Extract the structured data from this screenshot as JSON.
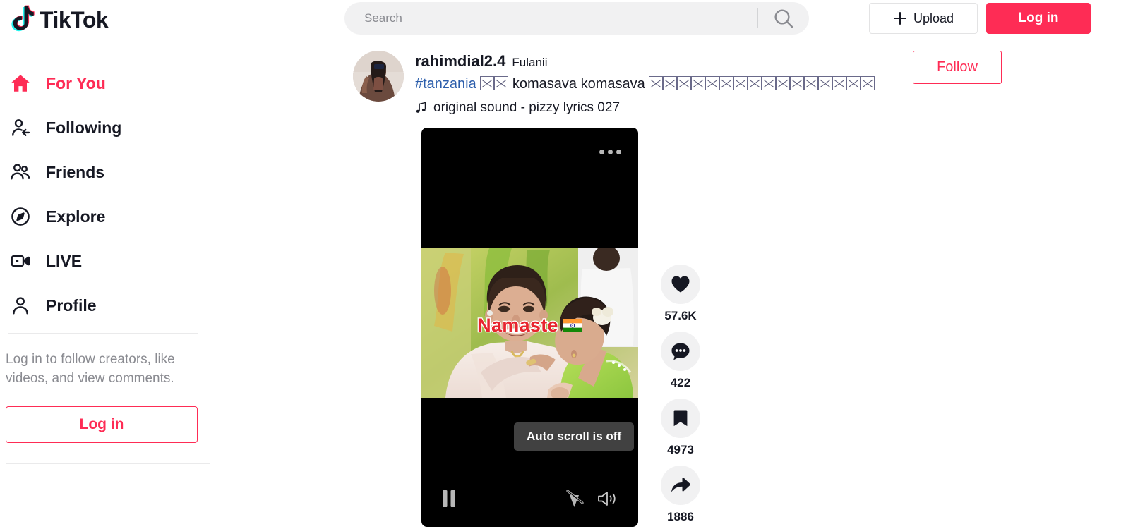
{
  "brand": {
    "name": "TikTok",
    "accent": "#fe2c55",
    "accent_cyan": "#25f4ee",
    "text": "#161823"
  },
  "topbar": {
    "logo_label": "TikTok",
    "search": {
      "placeholder": "Search",
      "value": "",
      "icon": "search-icon"
    },
    "upload": {
      "label": "Upload",
      "icon": "plus-icon"
    },
    "login": {
      "label": "Log in"
    }
  },
  "sidebar": {
    "items": [
      {
        "label": "For You",
        "icon": "home-icon",
        "active": true
      },
      {
        "label": "Following",
        "icon": "follow-icon",
        "active": false
      },
      {
        "label": "Friends",
        "icon": "friends-icon",
        "active": false
      },
      {
        "label": "Explore",
        "icon": "compass-icon",
        "active": false
      },
      {
        "label": "LIVE",
        "icon": "live-icon",
        "active": false
      },
      {
        "label": "Profile",
        "icon": "person-icon",
        "active": false
      }
    ],
    "login_prompt": "Log in to follow creators, like videos, and view comments.",
    "login_button": "Log in"
  },
  "post": {
    "username": "rahimdial2.4",
    "nickname": "Fulanii",
    "caption": {
      "hashtag": "#tanzania",
      "tofu_count_1": 2,
      "text": "komasava komasava",
      "tofu_count_2": 16
    },
    "music": {
      "icon": "music-note-icon",
      "label": "original sound - pizzy lyrics 027"
    },
    "follow_button": "Follow",
    "avatar": "avatar"
  },
  "player": {
    "more_icon": "more-dots-icon",
    "overlay_caption": "Namaste",
    "overlay_flag": "india-flag-emoji",
    "toast": "Auto scroll is off",
    "controls": {
      "play": {
        "icon": "pause-icon",
        "state": "playing"
      },
      "autoscroll": {
        "icon": "autoscroll-off-icon",
        "state": "off"
      },
      "volume": {
        "icon": "volume-on-icon",
        "state": "on"
      }
    }
  },
  "actions": [
    {
      "name": "like",
      "icon": "heart-icon",
      "count": "57.6K"
    },
    {
      "name": "comment",
      "icon": "comment-icon",
      "count": "422"
    },
    {
      "name": "bookmark",
      "icon": "bookmark-icon",
      "count": "4973"
    },
    {
      "name": "share",
      "icon": "share-icon",
      "count": "1886"
    }
  ]
}
